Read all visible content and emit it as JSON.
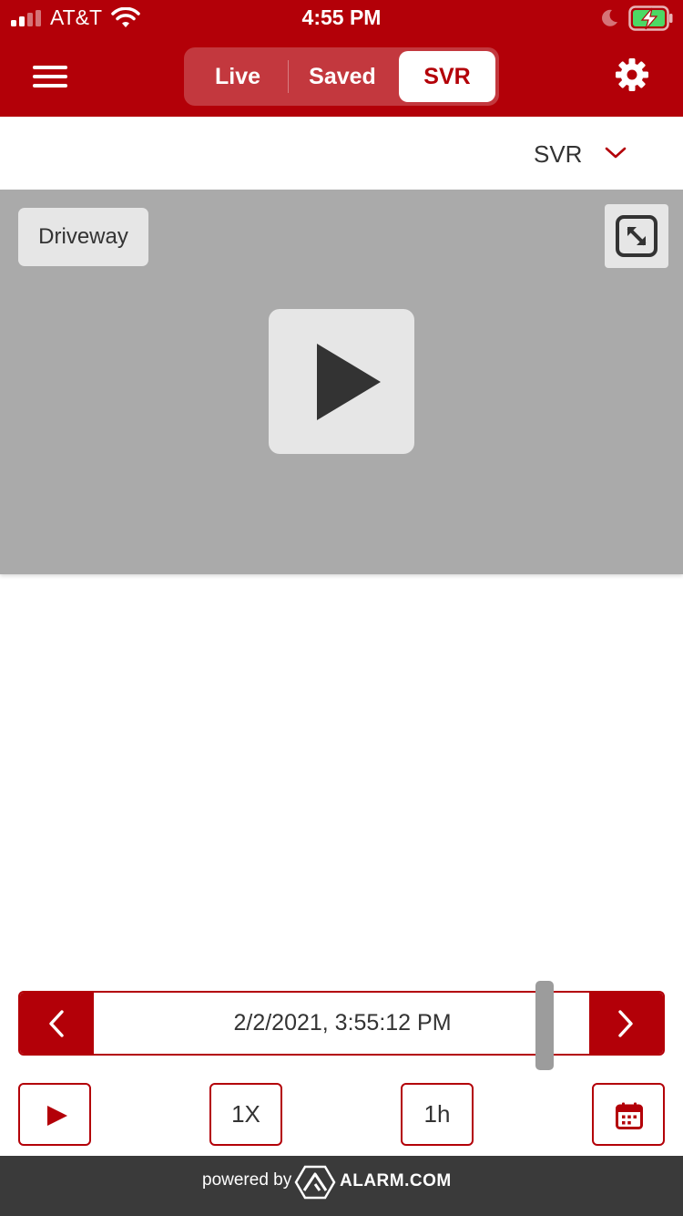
{
  "status_bar": {
    "carrier": "AT&T",
    "time": "4:55 PM",
    "icons": [
      "signal-icon",
      "wifi-icon",
      "moon-icon",
      "battery-charging-icon"
    ]
  },
  "header": {
    "tabs": [
      {
        "label": "Live",
        "active": false
      },
      {
        "label": "Saved",
        "active": false
      },
      {
        "label": "SVR",
        "active": true
      }
    ],
    "menu_icon": "hamburger-menu-icon",
    "settings_icon": "gear-icon"
  },
  "filter": {
    "selected": "SVR"
  },
  "video": {
    "camera_label": "Driveway",
    "expand_icon": "expand-icon",
    "play_icon": "play-icon"
  },
  "timeline": {
    "timestamp": "2/2/2021, 3:55:12 PM"
  },
  "controls": {
    "speed": "1X",
    "range": "1h",
    "play_icon": "play-icon",
    "calendar_icon": "calendar-icon"
  },
  "footer": {
    "powered_by": "powered by",
    "brand": "ALARM.COM"
  },
  "colors": {
    "accent": "#b30008",
    "video_bg": "#aaaaaa",
    "footer_bg": "#3a3a3a"
  }
}
